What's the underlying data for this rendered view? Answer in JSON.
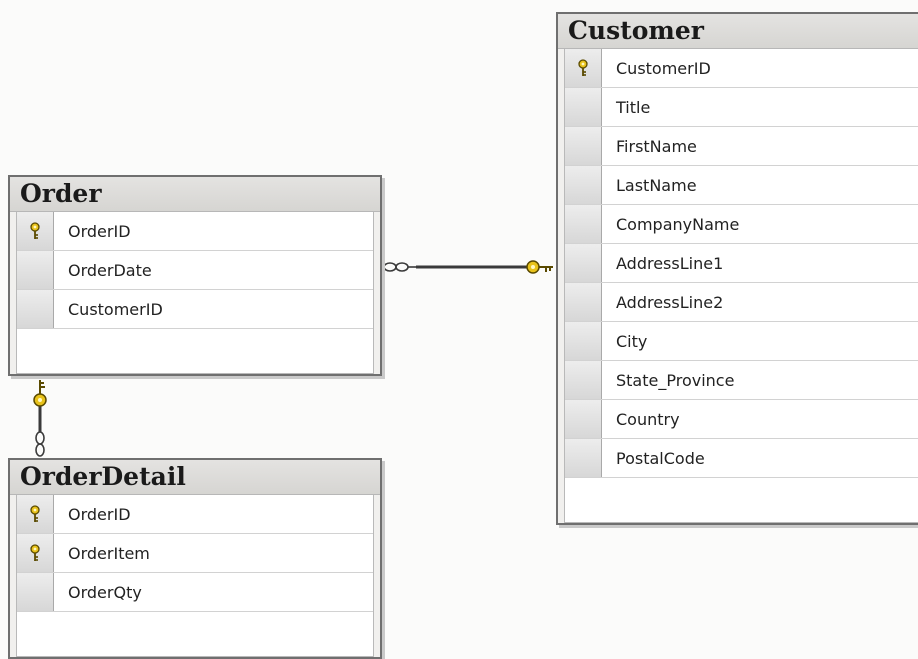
{
  "tables": {
    "order": {
      "title": "Order",
      "columns": [
        {
          "name": "OrderID",
          "key": true
        },
        {
          "name": "OrderDate",
          "key": false
        },
        {
          "name": "CustomerID",
          "key": false
        }
      ]
    },
    "orderdetail": {
      "title": "OrderDetail",
      "columns": [
        {
          "name": "OrderID",
          "key": true
        },
        {
          "name": "OrderItem",
          "key": true
        },
        {
          "name": "OrderQty",
          "key": false
        }
      ]
    },
    "customer": {
      "title": "Customer",
      "columns": [
        {
          "name": "CustomerID",
          "key": true
        },
        {
          "name": "Title",
          "key": false
        },
        {
          "name": "FirstName",
          "key": false
        },
        {
          "name": "LastName",
          "key": false
        },
        {
          "name": "CompanyName",
          "key": false
        },
        {
          "name": "AddressLine1",
          "key": false
        },
        {
          "name": "AddressLine2",
          "key": false
        },
        {
          "name": "City",
          "key": false
        },
        {
          "name": "State_Province",
          "key": false
        },
        {
          "name": "Country",
          "key": false
        },
        {
          "name": "PostalCode",
          "key": false
        }
      ]
    }
  },
  "colors": {
    "key": "#e8c21a",
    "border": "#6f6f6f",
    "connector": "#3a3a3a"
  }
}
